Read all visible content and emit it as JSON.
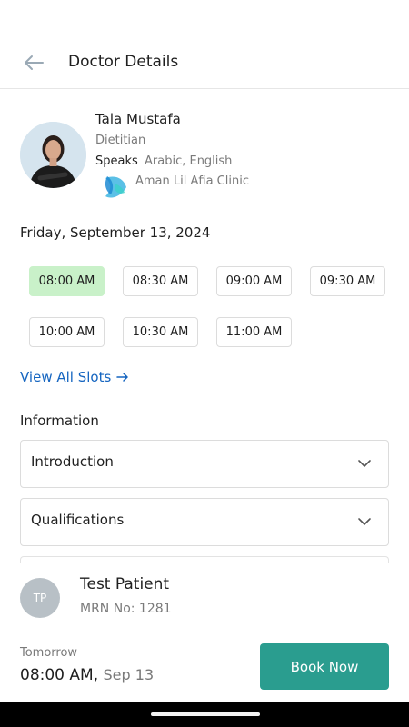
{
  "header": {
    "title": "Doctor Details",
    "back_icon": "arrow-left-icon"
  },
  "doctor": {
    "name": "Tala Mustafa",
    "specialty": "Dietitian",
    "speaks_label": "Speaks",
    "languages": "Arabic, English",
    "clinic": "Aman Lil Afia Clinic"
  },
  "schedule": {
    "date": "Friday, September 13, 2024",
    "slots": [
      {
        "label": "08:00 AM",
        "selected": true
      },
      {
        "label": "08:30 AM",
        "selected": false
      },
      {
        "label": "09:00 AM",
        "selected": false
      },
      {
        "label": "09:30 AM",
        "selected": false
      },
      {
        "label": "10:00 AM",
        "selected": false
      },
      {
        "label": "10:30 AM",
        "selected": false
      },
      {
        "label": "11:00 AM",
        "selected": false
      }
    ],
    "view_all": "View All Slots"
  },
  "information": {
    "label": "Information",
    "sections": [
      {
        "label": "Introduction"
      },
      {
        "label": "Qualifications"
      }
    ]
  },
  "patient": {
    "initials": "TP",
    "name": "Test Patient",
    "mrn": "MRN No: 1281"
  },
  "footer": {
    "day": "Tomorrow",
    "time": "08:00 AM,",
    "date": "Sep 13",
    "book_label": "Book Now"
  },
  "colors": {
    "accent": "#2a9d8f",
    "selected_slot": "#c9f1c9",
    "link": "#1565c0"
  }
}
